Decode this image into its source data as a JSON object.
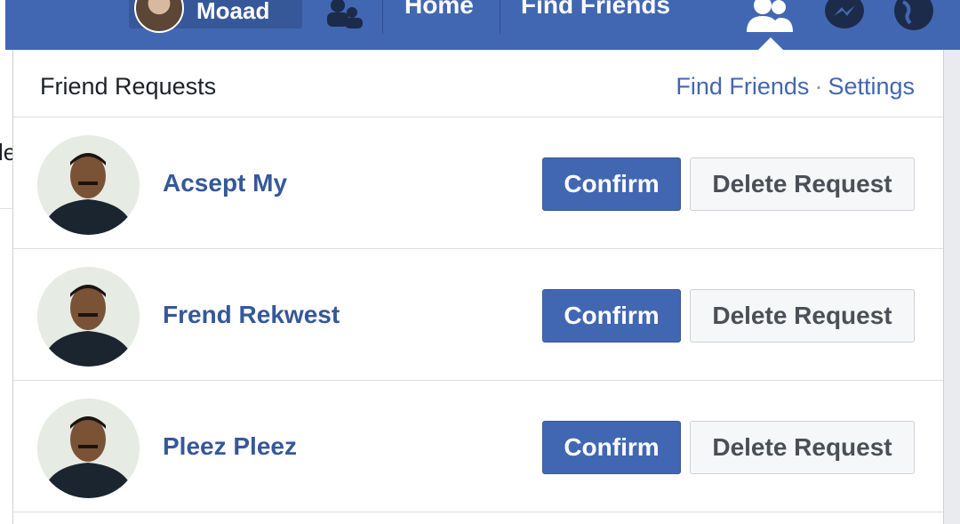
{
  "topbar": {
    "profile_name": "Moaad",
    "nav_links": [
      "Home",
      "Find Friends"
    ],
    "colors": {
      "bar": "#4267b2",
      "chip": "#365899"
    }
  },
  "panel": {
    "title": "Friend Requests",
    "links": {
      "find_friends": "Find Friends",
      "separator": "·",
      "settings": "Settings"
    }
  },
  "requests": [
    {
      "name": "Acsept My",
      "confirm_label": "Confirm",
      "delete_label": "Delete Request"
    },
    {
      "name": "Frend Rekwest",
      "confirm_label": "Confirm",
      "delete_label": "Delete Request"
    },
    {
      "name": "Pleez Pleez",
      "confirm_label": "Confirm",
      "delete_label": "Delete Request"
    }
  ],
  "left_page": {
    "glyph": "le"
  },
  "icons": [
    "friend-requests-icon",
    "messenger-icon",
    "globe-notifications-icon",
    "friends-nav-icon"
  ]
}
